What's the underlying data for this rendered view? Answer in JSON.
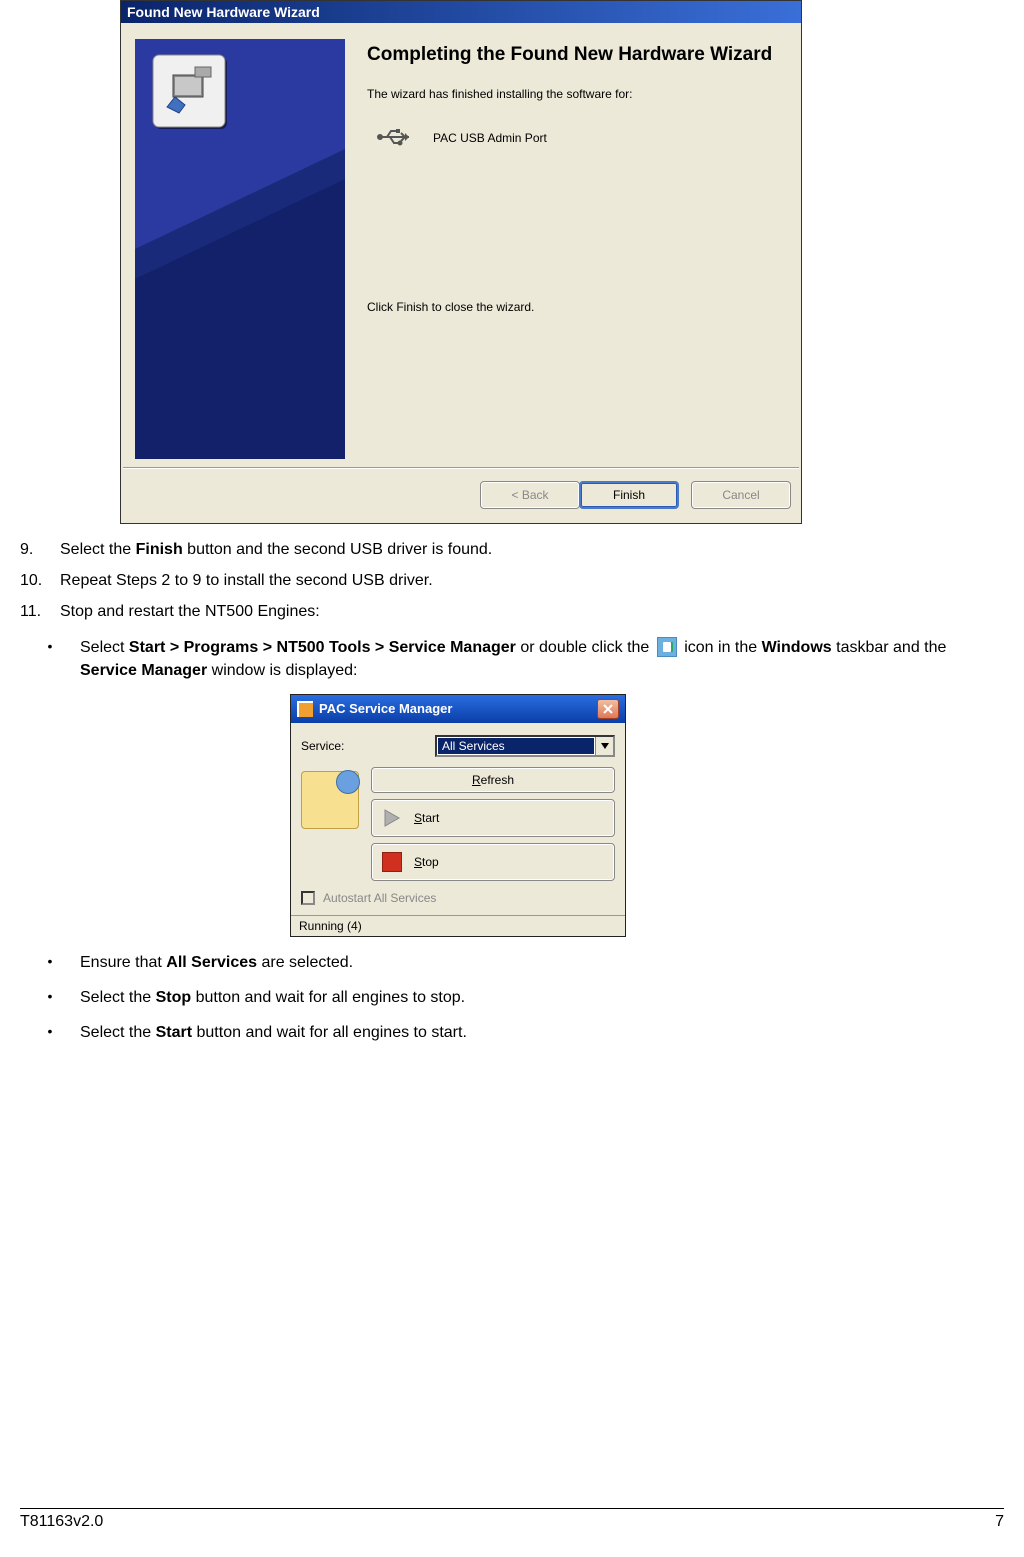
{
  "wizard": {
    "title": "Found New Hardware Wizard",
    "heading": "Completing the Found New Hardware Wizard",
    "subtext": "The wizard has finished installing the software for:",
    "device_name": "PAC USB Admin Port",
    "close_text": "Click Finish to close the wizard.",
    "buttons": {
      "back": "< Back",
      "finish": "Finish",
      "cancel": "Cancel"
    }
  },
  "instructions": {
    "step9": {
      "num": "9.",
      "pre": "Select the ",
      "bold": "Finish",
      "post": " button and the second USB driver is found."
    },
    "step10": {
      "num": "10.",
      "text": "Repeat Steps 2 to 9 to install the second USB driver."
    },
    "step11": {
      "num": "11.",
      "text": "Stop and restart the NT500 Engines:"
    },
    "bullet1": {
      "a": "Select ",
      "b": "Start > Programs > NT500 Tools > Service Manager",
      "c": " or double click the ",
      "d": " icon in the ",
      "e": "Windows",
      "f": " taskbar and the ",
      "g": "Service Manager",
      "h": " window is displayed:"
    },
    "bullet2": {
      "a": "Ensure that ",
      "b": "All Services",
      "c": " are selected."
    },
    "bullet3": {
      "a": "Select the ",
      "b": "Stop",
      "c": " button and wait for all engines to stop."
    },
    "bullet4": {
      "a": "Select the ",
      "b": "Start",
      "c": " button and wait for  all engines to start."
    }
  },
  "service_manager": {
    "title": "PAC Service Manager",
    "service_label": "Service:",
    "service_value": "All Services",
    "refresh_underline": "R",
    "refresh_rest": "efresh",
    "start_underline": "S",
    "start_rest": "tart",
    "stop_underline": "S",
    "stop_rest": "top",
    "autostart": "Autostart All Services",
    "status": "Running (4)"
  },
  "footer": {
    "left": "T81163v2.0",
    "right": "7"
  },
  "bullet_char": "•"
}
